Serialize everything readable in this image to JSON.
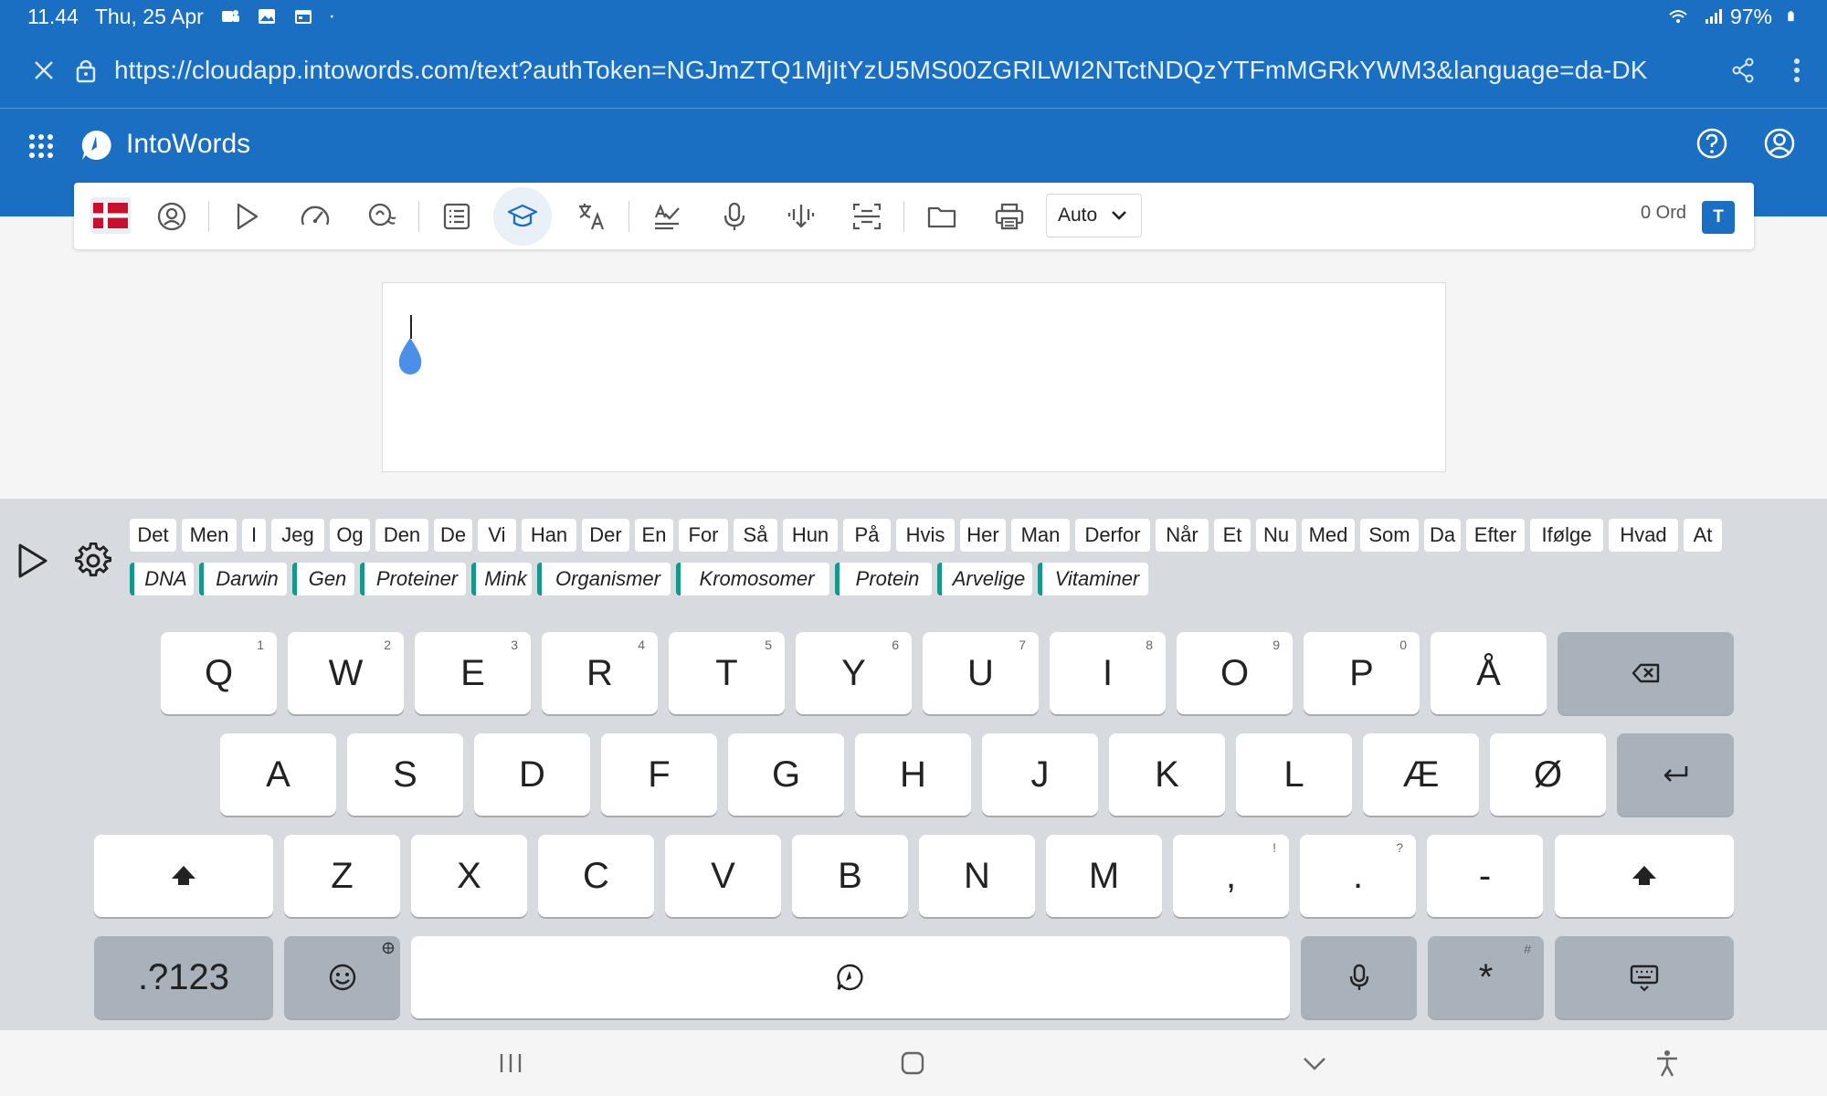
{
  "status_bar": {
    "time": "11.44",
    "date": "Thu, 25 Apr",
    "battery": "97%",
    "icons": [
      "teams-icon",
      "gallery-icon",
      "calendar-icon",
      "dot-icon",
      "wifi-icon",
      "signal-icon",
      "battery-icon"
    ]
  },
  "browser": {
    "url": "https://cloudapp.intowords.com/text?authToken=NGJmZTQ1MjItYzU5MS00ZGRlLWI2NTctNDQzYTFmMGRkYWM3&language=da-DK"
  },
  "app": {
    "title": "IntoWords"
  },
  "toolbar": {
    "speed_mode": "Auto",
    "word_count": "0 Ord",
    "badge": "T",
    "language_flag_colors": {
      "red": "#c8102e",
      "white": "#ffffff"
    }
  },
  "suggestions": {
    "words": [
      "Det",
      "Men",
      "I",
      "Jeg",
      "Og",
      "Den",
      "De",
      "Vi",
      "Han",
      "Der",
      "En",
      "For",
      "Så",
      "Hun",
      "På",
      "Hvis",
      "Her",
      "Man",
      "Derfor",
      "Når",
      "Et",
      "Nu",
      "Med",
      "Som",
      "Da",
      "Efter",
      "Ifølge",
      "Hvad",
      "At"
    ],
    "topic_words": [
      "DNA",
      "Darwin",
      "Gen",
      "Proteiner",
      "Mink",
      "Organismer",
      "Kromosomer",
      "Protein",
      "Arvelige",
      "Vitaminer"
    ]
  },
  "keyboard": {
    "row1": [
      {
        "label": "Q",
        "hint": "1"
      },
      {
        "label": "W",
        "hint": "2"
      },
      {
        "label": "E",
        "hint": "3"
      },
      {
        "label": "R",
        "hint": "4"
      },
      {
        "label": "T",
        "hint": "5"
      },
      {
        "label": "Y",
        "hint": "6"
      },
      {
        "label": "U",
        "hint": "7"
      },
      {
        "label": "I",
        "hint": "8"
      },
      {
        "label": "O",
        "hint": "9"
      },
      {
        "label": "P",
        "hint": "0"
      },
      {
        "label": "Å",
        "hint": ""
      }
    ],
    "row2": [
      "A",
      "S",
      "D",
      "F",
      "G",
      "H",
      "J",
      "K",
      "L",
      "Æ",
      "Ø"
    ],
    "row3": [
      {
        "label": "Z",
        "hint": ""
      },
      {
        "label": "X",
        "hint": ""
      },
      {
        "label": "C",
        "hint": ""
      },
      {
        "label": "V",
        "hint": ""
      },
      {
        "label": "B",
        "hint": ""
      },
      {
        "label": "N",
        "hint": ""
      },
      {
        "label": "M",
        "hint": ""
      },
      {
        "label": ",",
        "hint": "!"
      },
      {
        "label": ".",
        "hint": "?"
      },
      {
        "label": "-",
        "hint": ""
      }
    ],
    "symbols_key": ".?123",
    "star_key": "*",
    "star_hint": "#"
  },
  "colors": {
    "brand_blue": "#1a6fc2",
    "topic_accent": "#15978a",
    "keyboard_bg": "#d7dbe0",
    "dark_key": "#a9b1bb"
  }
}
